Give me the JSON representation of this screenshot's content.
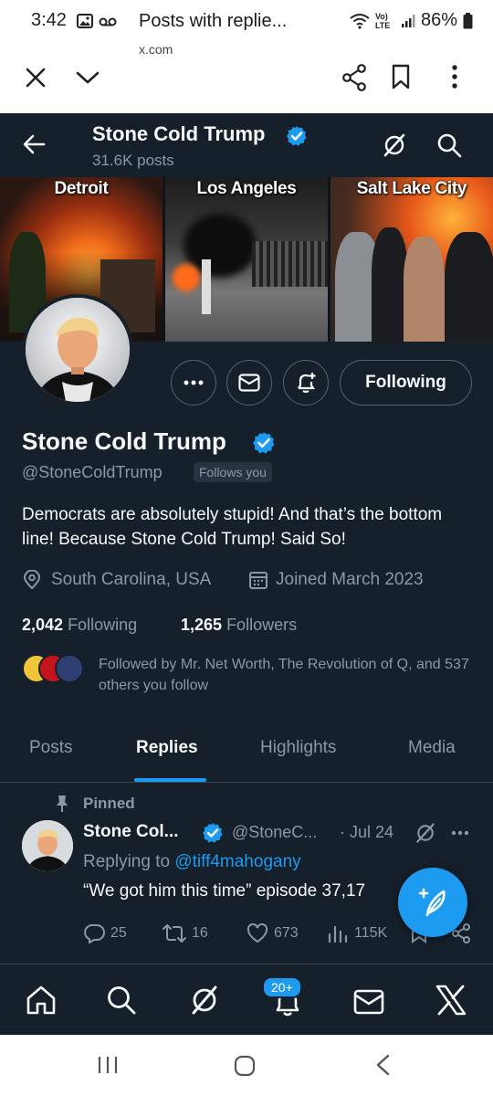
{
  "status_bar": {
    "time": "3:42",
    "battery": "86%",
    "network": "Vo) LTE"
  },
  "custom_tab": {
    "title": "Posts with replie...",
    "url": "x.com"
  },
  "header": {
    "name": "Stone Cold Trump",
    "posts_count": "31.6K posts"
  },
  "banner": {
    "panels": [
      "Detroit",
      "Los Angeles",
      "Salt Lake City"
    ]
  },
  "profile": {
    "following_button": "Following",
    "name": "Stone Cold Trump",
    "handle": "@StoneColdTrump",
    "follows_you": "Follows you",
    "bio": "Democrats are absolutely stupid! And that’s the bottom line! Because Stone Cold Trump! Said So!",
    "location": "South Carolina, USA",
    "joined": "Joined March 2023",
    "following_count": "2,042",
    "following_label": "Following",
    "followers_count": "1,265",
    "followers_label": "Followers",
    "followed_by": "Followed by Mr. Net Worth, The Revolution of Q, and 537 others you follow"
  },
  "tabs": [
    {
      "label": "Posts",
      "active": false
    },
    {
      "label": "Replies",
      "active": true
    },
    {
      "label": "Highlights",
      "active": false
    },
    {
      "label": "Media",
      "active": false
    }
  ],
  "pinned_post": {
    "pinned_label": "Pinned",
    "name": "Stone Col...",
    "handle": "@StoneC...",
    "date": "· Jul 24",
    "replying_to_prefix": "Replying to",
    "replying_to": "@tiff4mahogany",
    "text": "“We got him this time” episode 37,17",
    "replies": "25",
    "reposts": "16",
    "likes": "673",
    "views": "115K"
  },
  "bottom_nav": {
    "notifications_badge": "20+"
  },
  "colors": {
    "background": "#15202b",
    "accent": "#1d9bf0",
    "secondary_text": "#8b98a5",
    "border": "#38444d"
  }
}
